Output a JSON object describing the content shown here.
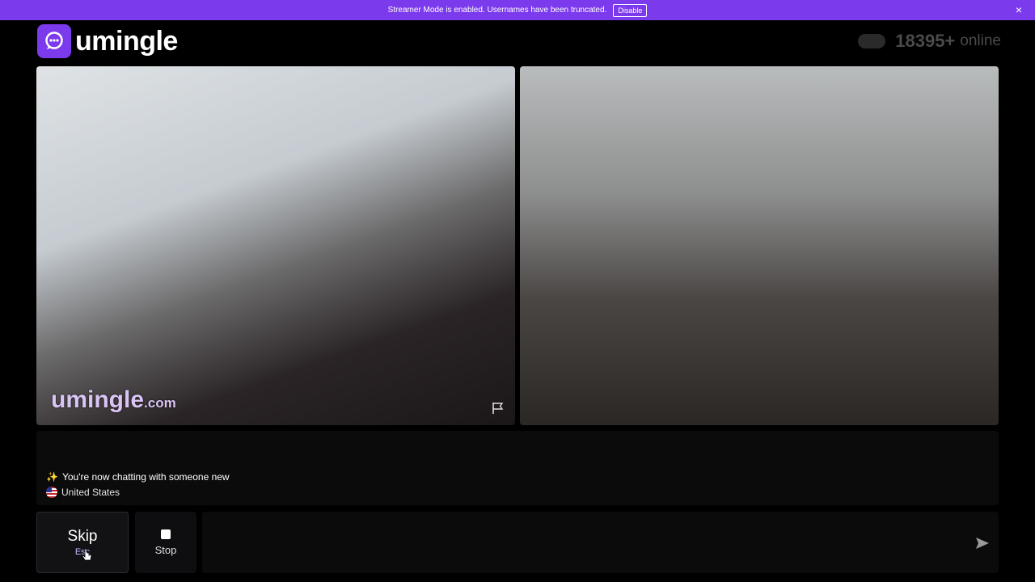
{
  "banner": {
    "message": "Streamer Mode is enabled. Usernames have been truncated.",
    "disable_label": "Disable",
    "close_icon": "×",
    "color": "#7c3aed"
  },
  "brand": {
    "name": "umingle",
    "icon": "chat-bubble-icon",
    "color": "#7c3aed"
  },
  "online": {
    "count": "18395+",
    "label": "online"
  },
  "videos": {
    "left": {
      "watermark": "umingle",
      "watermark_suffix": ".com",
      "report_icon": "flag-icon"
    },
    "right": {}
  },
  "chat": {
    "status_icon": "✨",
    "status": "You're now chatting with someone new",
    "country": "United States",
    "country_flag": "flag-us-icon"
  },
  "controls": {
    "skip_label": "Skip",
    "skip_hint": "Esc",
    "stop_label": "Stop",
    "message_placeholder": "",
    "send_icon": "send-icon"
  }
}
